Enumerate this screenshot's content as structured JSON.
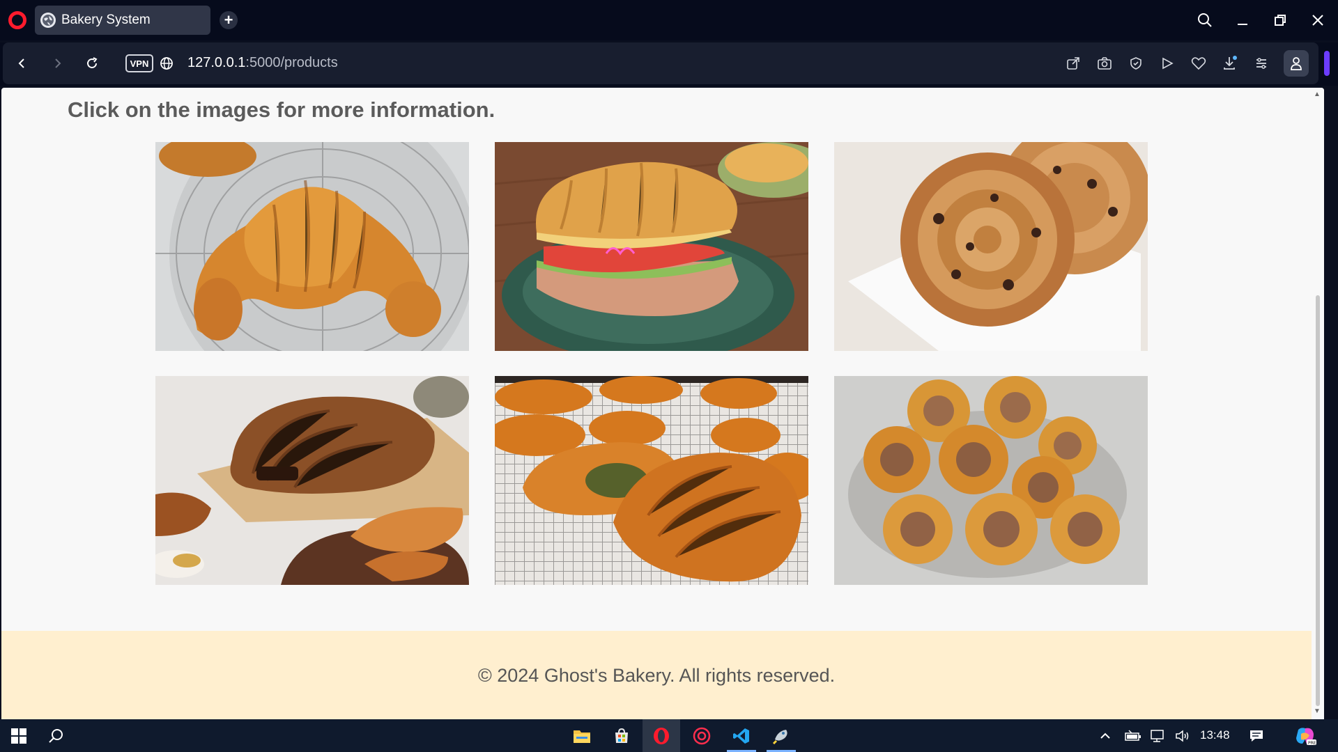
{
  "browser": {
    "tab_title": "Bakery System",
    "address": {
      "host": "127.0.0.1",
      "path": ":5000/products"
    },
    "vpn_label": "VPN"
  },
  "page": {
    "heading": "Click on the images for more information.",
    "products": [
      {
        "name": "croissant-image",
        "icon": "croissant"
      },
      {
        "name": "croissant-sandwich-image",
        "icon": "sandwich"
      },
      {
        "name": "pain-aux-raisins-image",
        "icon": "raisin-swirl"
      },
      {
        "name": "pain-au-chocolat-image",
        "icon": "chocolate-pastry"
      },
      {
        "name": "pistachio-pastry-image",
        "icon": "pastry-rack"
      },
      {
        "name": "sausage-rolls-image",
        "icon": "sausage-rolls"
      }
    ],
    "footer": "© 2024 Ghost's Bakery. All rights reserved."
  },
  "taskbar": {
    "clock": "13:48"
  },
  "colors": {
    "browser_bg": "#060b1c",
    "page_bg": "#f8f8f8",
    "footer_bg": "#ffefcf",
    "opera_red": "#ff1b2d",
    "taskbar_bg": "#0f1a2d"
  }
}
